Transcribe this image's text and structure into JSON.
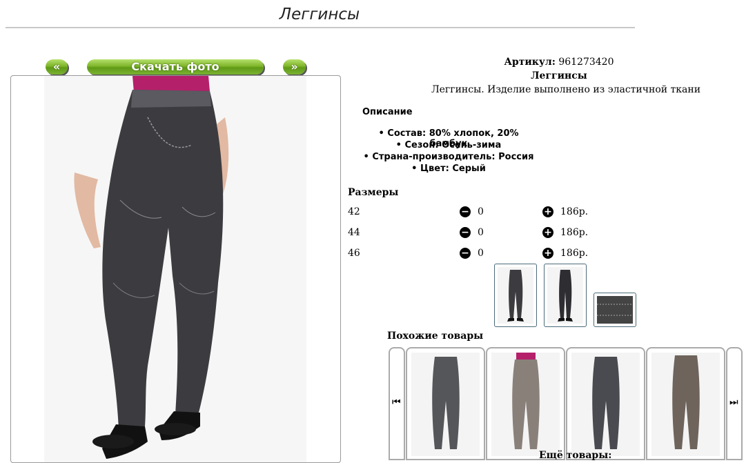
{
  "page": {
    "title": "Леггинсы"
  },
  "photo_nav": {
    "prev_label": "«",
    "download_label": "Скачать фото",
    "next_label": "»"
  },
  "product": {
    "article_label": "Артикул:",
    "article_value": "961273420",
    "name": "Леггинсы",
    "short_desc": "Леггинсы. Изделие выполнено из эластичной ткани"
  },
  "description": {
    "title": "Описание",
    "items": [
      "Состав: 80% хлопок, 20% бамбук",
      "Сезон: Осень-зима",
      "Страна-производитель: Россия",
      "Цвет: Серый"
    ]
  },
  "sizes": {
    "title": "Размеры",
    "rows": [
      {
        "size": "42",
        "qty": "0",
        "price": "186р."
      },
      {
        "size": "44",
        "qty": "0",
        "price": "186р."
      },
      {
        "size": "46",
        "qty": "0",
        "price": "186р."
      }
    ]
  },
  "similar": {
    "title": "Похожие товары"
  },
  "more": {
    "title": "Ещё товары:"
  },
  "colors": {
    "button_green": "#7fb52a",
    "frame_border": "#999999",
    "thumb_border": "#4a6a7a"
  }
}
